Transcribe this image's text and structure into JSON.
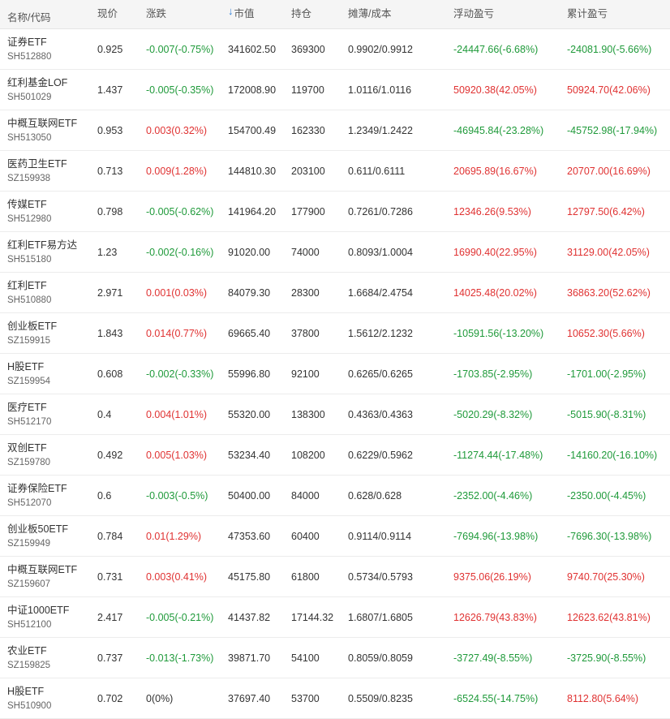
{
  "colors": {
    "up": "#e03232",
    "down": "#1f9a3a",
    "sort_accent": "#2f7fd8"
  },
  "header": {
    "name": "名称/代码",
    "price": "现价",
    "change": "涨跌",
    "market_value_icon": "arrow-down-icon",
    "market_value": "市值",
    "quantity": "持仓",
    "cost": "摊薄/成本",
    "floating_pl": "浮动盈亏",
    "cumulative_pl": "累计盈亏"
  },
  "rows": [
    {
      "name": "证券ETF",
      "code": "SH512880",
      "price": "0.925",
      "change": "-0.007(-0.75%)",
      "change_dir": "down",
      "market_value": "341602.50",
      "quantity": "369300",
      "cost": "0.9902/0.9912",
      "floating_pl": "-24447.66(-6.68%)",
      "floating_dir": "down",
      "cumulative_pl": "-24081.90(-5.66%)",
      "cumulative_dir": "down"
    },
    {
      "name": "红利基金LOF",
      "code": "SH501029",
      "price": "1.437",
      "change": "-0.005(-0.35%)",
      "change_dir": "down",
      "market_value": "172008.90",
      "quantity": "119700",
      "cost": "1.0116/1.0116",
      "floating_pl": "50920.38(42.05%)",
      "floating_dir": "up",
      "cumulative_pl": "50924.70(42.06%)",
      "cumulative_dir": "up"
    },
    {
      "name": "中概互联网ETF",
      "code": "SH513050",
      "price": "0.953",
      "change": "0.003(0.32%)",
      "change_dir": "up",
      "market_value": "154700.49",
      "quantity": "162330",
      "cost": "1.2349/1.2422",
      "floating_pl": "-46945.84(-23.28%)",
      "floating_dir": "down",
      "cumulative_pl": "-45752.98(-17.94%)",
      "cumulative_dir": "down"
    },
    {
      "name": "医药卫生ETF",
      "code": "SZ159938",
      "price": "0.713",
      "change": "0.009(1.28%)",
      "change_dir": "up",
      "market_value": "144810.30",
      "quantity": "203100",
      "cost": "0.611/0.6111",
      "floating_pl": "20695.89(16.67%)",
      "floating_dir": "up",
      "cumulative_pl": "20707.00(16.69%)",
      "cumulative_dir": "up"
    },
    {
      "name": "传媒ETF",
      "code": "SH512980",
      "price": "0.798",
      "change": "-0.005(-0.62%)",
      "change_dir": "down",
      "market_value": "141964.20",
      "quantity": "177900",
      "cost": "0.7261/0.7286",
      "floating_pl": "12346.26(9.53%)",
      "floating_dir": "up",
      "cumulative_pl": "12797.50(6.42%)",
      "cumulative_dir": "up"
    },
    {
      "name": "红利ETF易方达",
      "code": "SH515180",
      "price": "1.23",
      "change": "-0.002(-0.16%)",
      "change_dir": "down",
      "market_value": "91020.00",
      "quantity": "74000",
      "cost": "0.8093/1.0004",
      "floating_pl": "16990.40(22.95%)",
      "floating_dir": "up",
      "cumulative_pl": "31129.00(42.05%)",
      "cumulative_dir": "up"
    },
    {
      "name": "红利ETF",
      "code": "SH510880",
      "price": "2.971",
      "change": "0.001(0.03%)",
      "change_dir": "up",
      "market_value": "84079.30",
      "quantity": "28300",
      "cost": "1.6684/2.4754",
      "floating_pl": "14025.48(20.02%)",
      "floating_dir": "up",
      "cumulative_pl": "36863.20(52.62%)",
      "cumulative_dir": "up"
    },
    {
      "name": "创业板ETF",
      "code": "SZ159915",
      "price": "1.843",
      "change": "0.014(0.77%)",
      "change_dir": "up",
      "market_value": "69665.40",
      "quantity": "37800",
      "cost": "1.5612/2.1232",
      "floating_pl": "-10591.56(-13.20%)",
      "floating_dir": "down",
      "cumulative_pl": "10652.30(5.66%)",
      "cumulative_dir": "up"
    },
    {
      "name": "H股ETF",
      "code": "SZ159954",
      "price": "0.608",
      "change": "-0.002(-0.33%)",
      "change_dir": "down",
      "market_value": "55996.80",
      "quantity": "92100",
      "cost": "0.6265/0.6265",
      "floating_pl": "-1703.85(-2.95%)",
      "floating_dir": "down",
      "cumulative_pl": "-1701.00(-2.95%)",
      "cumulative_dir": "down"
    },
    {
      "name": "医疗ETF",
      "code": "SH512170",
      "price": "0.4",
      "change": "0.004(1.01%)",
      "change_dir": "up",
      "market_value": "55320.00",
      "quantity": "138300",
      "cost": "0.4363/0.4363",
      "floating_pl": "-5020.29(-8.32%)",
      "floating_dir": "down",
      "cumulative_pl": "-5015.90(-8.31%)",
      "cumulative_dir": "down"
    },
    {
      "name": "双创ETF",
      "code": "SZ159780",
      "price": "0.492",
      "change": "0.005(1.03%)",
      "change_dir": "up",
      "market_value": "53234.40",
      "quantity": "108200",
      "cost": "0.6229/0.5962",
      "floating_pl": "-11274.44(-17.48%)",
      "floating_dir": "down",
      "cumulative_pl": "-14160.20(-16.10%)",
      "cumulative_dir": "down"
    },
    {
      "name": "证券保险ETF",
      "code": "SH512070",
      "price": "0.6",
      "change": "-0.003(-0.5%)",
      "change_dir": "down",
      "market_value": "50400.00",
      "quantity": "84000",
      "cost": "0.628/0.628",
      "floating_pl": "-2352.00(-4.46%)",
      "floating_dir": "down",
      "cumulative_pl": "-2350.00(-4.45%)",
      "cumulative_dir": "down"
    },
    {
      "name": "创业板50ETF",
      "code": "SZ159949",
      "price": "0.784",
      "change": "0.01(1.29%)",
      "change_dir": "up",
      "market_value": "47353.60",
      "quantity": "60400",
      "cost": "0.9114/0.9114",
      "floating_pl": "-7694.96(-13.98%)",
      "floating_dir": "down",
      "cumulative_pl": "-7696.30(-13.98%)",
      "cumulative_dir": "down"
    },
    {
      "name": "中概互联网ETF",
      "code": "SZ159607",
      "price": "0.731",
      "change": "0.003(0.41%)",
      "change_dir": "up",
      "market_value": "45175.80",
      "quantity": "61800",
      "cost": "0.5734/0.5793",
      "floating_pl": "9375.06(26.19%)",
      "floating_dir": "up",
      "cumulative_pl": "9740.70(25.30%)",
      "cumulative_dir": "up"
    },
    {
      "name": "中证1000ETF",
      "code": "SH512100",
      "price": "2.417",
      "change": "-0.005(-0.21%)",
      "change_dir": "down",
      "market_value": "41437.82",
      "quantity": "17144.32",
      "cost": "1.6807/1.6805",
      "floating_pl": "12626.79(43.83%)",
      "floating_dir": "up",
      "cumulative_pl": "12623.62(43.81%)",
      "cumulative_dir": "up"
    },
    {
      "name": "农业ETF",
      "code": "SZ159825",
      "price": "0.737",
      "change": "-0.013(-1.73%)",
      "change_dir": "down",
      "market_value": "39871.70",
      "quantity": "54100",
      "cost": "0.8059/0.8059",
      "floating_pl": "-3727.49(-8.55%)",
      "floating_dir": "down",
      "cumulative_pl": "-3725.90(-8.55%)",
      "cumulative_dir": "down"
    },
    {
      "name": "H股ETF",
      "code": "SH510900",
      "price": "0.702",
      "change": "0(0%)",
      "change_dir": "flat",
      "market_value": "37697.40",
      "quantity": "53700",
      "cost": "0.5509/0.8235",
      "floating_pl": "-6524.55(-14.75%)",
      "floating_dir": "down",
      "cumulative_pl": "8112.80(5.64%)",
      "cumulative_dir": "up"
    }
  ]
}
